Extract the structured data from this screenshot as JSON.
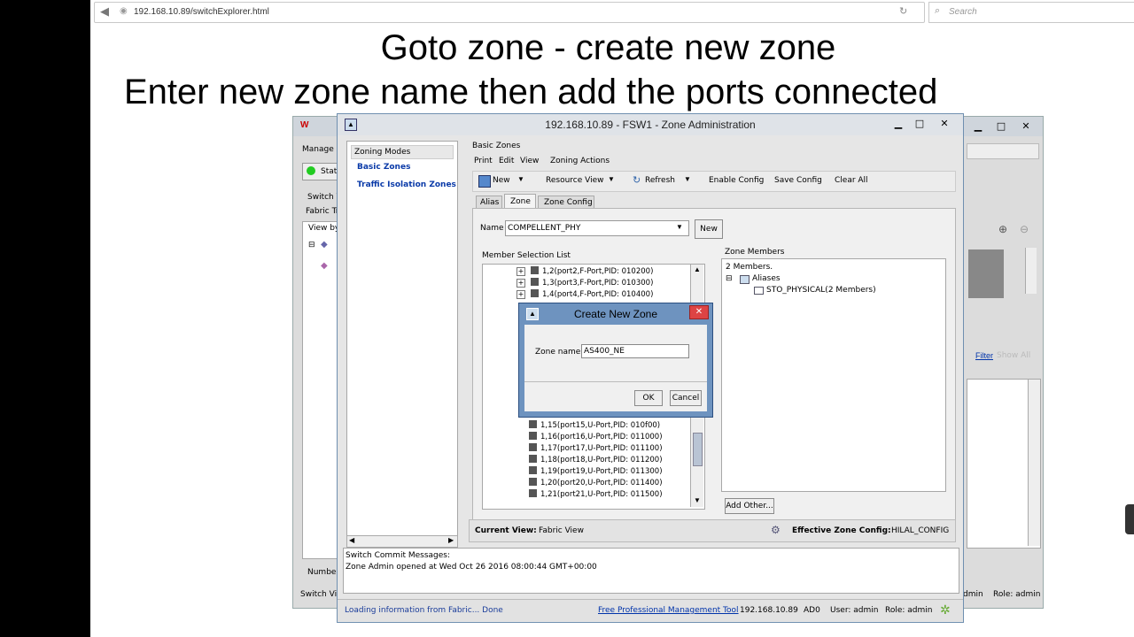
{
  "browser": {
    "url": "192.168.10.89/switchExplorer.html",
    "search_placeholder": "Search"
  },
  "captions": {
    "line1": "Goto zone - create new zone",
    "line2": "Enter new zone name then add the ports connected"
  },
  "bg_window": {
    "manage": "Manage",
    "status": "Stat",
    "switch_view": "Switch V",
    "fabric_tree": "Fabric Tr",
    "view_by": "View by",
    "number": "Number",
    "switch_view2": "Switch Vi",
    "filter": "Filter",
    "show_all": "Show All",
    "role_admin_1": "dmin",
    "role_admin_2": "Role: admin"
  },
  "zone_admin": {
    "title": "192.168.10.89 - FSW1 - Zone Administration",
    "zoning_modes": "Zoning Modes",
    "modes": [
      "Basic Zones",
      "Traffic Isolation Zones"
    ],
    "panel_title": "Basic Zones",
    "menu": [
      "Print",
      "Edit",
      "View",
      "Zoning Actions"
    ],
    "toolbar": {
      "new": "New",
      "resource_view": "Resource View",
      "refresh": "Refresh",
      "enable_config": "Enable Config",
      "save_config": "Save Config",
      "clear_all": "Clear All"
    },
    "tabs": [
      "Alias",
      "Zone",
      "Zone Config"
    ],
    "name_label": "Name",
    "name_value": "COMPELLENT_PHY",
    "new_button": "New",
    "member_list_title": "Member Selection List",
    "members_top": [
      "1,2(port2,F-Port,PID: 010200)",
      "1,3(port3,F-Port,PID: 010300)",
      "1,4(port4,F-Port,PID: 010400)"
    ],
    "members_bottom": [
      "1,15(port15,U-Port,PID: 010f00)",
      "1,16(port16,U-Port,PID: 011000)",
      "1,17(port17,U-Port,PID: 011100)",
      "1,18(port18,U-Port,PID: 011200)",
      "1,19(port19,U-Port,PID: 011300)",
      "1,20(port20,U-Port,PID: 011400)",
      "1,21(port21,U-Port,PID: 011500)"
    ],
    "zone_members_title": "Zone Members",
    "members_count": "2 Members.",
    "aliases_label": "Aliases",
    "alias_entry": "STO_PHYSICAL(2 Members)",
    "add_other": "Add Other...",
    "current_view_label": "Current View:",
    "current_view_value": "Fabric View",
    "effective_label": "Effective Zone Config:",
    "effective_value": "HILAL_CONFIG",
    "commit_label": "Switch Commit Messages:",
    "commit_message": "Zone Admin opened at Wed Oct 26 2016 08:00:44 GMT+00:00",
    "status_loading": "Loading information from Fabric... Done",
    "status_link": "Free Professional Management Tool",
    "status_ip": "192.168.10.89",
    "status_ad": "AD0",
    "status_user": "User: admin",
    "status_role": "Role: admin"
  },
  "dialog": {
    "title": "Create New Zone",
    "label": "Zone name",
    "value": "AS400_NE",
    "ok": "OK",
    "cancel": "Cancel"
  }
}
